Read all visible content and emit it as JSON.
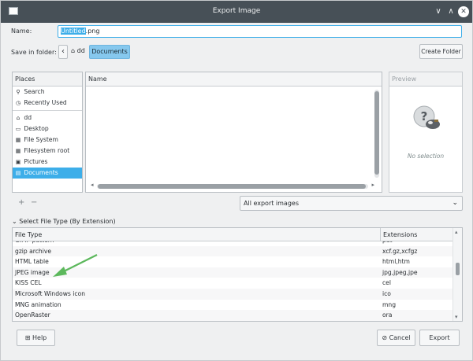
{
  "window": {
    "title": "Export Image",
    "controls": {
      "minimize": "∨",
      "maximize": "∧",
      "close": "✕"
    }
  },
  "name_row": {
    "label": "Name:",
    "value_selected": "Untitled",
    "value_rest": ".png"
  },
  "folder_row": {
    "label": "Save in folder:",
    "back": "‹",
    "home_label": "dd",
    "current": "Documents",
    "create_folder": "Create Folder"
  },
  "places": {
    "header": "Places",
    "items": [
      {
        "icon": "search-icon",
        "glyph": "⚲",
        "label": "Search"
      },
      {
        "icon": "recent-icon",
        "glyph": "◷",
        "label": "Recently Used"
      },
      {
        "icon": "home-icon",
        "glyph": "⌂",
        "label": "dd"
      },
      {
        "icon": "desktop-icon",
        "glyph": "▭",
        "label": "Desktop"
      },
      {
        "icon": "drive-icon",
        "glyph": "▦",
        "label": "File System"
      },
      {
        "icon": "drive-icon",
        "glyph": "▦",
        "label": "Filesystem root"
      },
      {
        "icon": "pictures-icon",
        "glyph": "▣",
        "label": "Pictures"
      },
      {
        "icon": "documents-icon",
        "glyph": "▤",
        "label": "Documents",
        "active": true
      }
    ]
  },
  "files": {
    "header": "Name"
  },
  "preview": {
    "header": "Preview",
    "status": "No selection"
  },
  "places_controls": {
    "add": "+",
    "remove": "−"
  },
  "filter": {
    "selected": "All export images"
  },
  "file_type_section": {
    "toggle": "Select File Type (By Extension)",
    "columns": [
      "File Type",
      "Extensions"
    ],
    "rows": [
      {
        "type": "GIMP pattern",
        "ext": "pat"
      },
      {
        "type": "gzip archive",
        "ext": "xcf.gz,xcfgz"
      },
      {
        "type": "HTML table",
        "ext": "html,htm"
      },
      {
        "type": "JPEG image",
        "ext": "jpg,jpeg,jpe"
      },
      {
        "type": "KISS CEL",
        "ext": "cel"
      },
      {
        "type": "Microsoft Windows icon",
        "ext": "ico"
      },
      {
        "type": "MNG animation",
        "ext": "mng"
      },
      {
        "type": "OpenRaster",
        "ext": "ora"
      }
    ]
  },
  "buttons": {
    "help": "Help",
    "cancel": "Cancel",
    "export": "Export"
  },
  "colors": {
    "accent": "#3daee9",
    "titlebar": "#475057",
    "annotation_arrow": "#5cb85c"
  }
}
